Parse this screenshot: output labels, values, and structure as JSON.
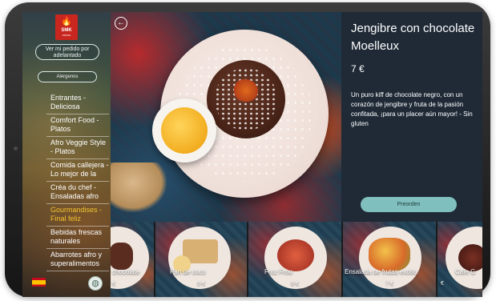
{
  "sidebar": {
    "logo": {
      "brand": "SMK",
      "sub": "SMOKE"
    },
    "order_button": "Ver mi pedido por adelantado",
    "allergens_button": "Alergenos",
    "categories": [
      {
        "label": "Entrantes - Deliciosa"
      },
      {
        "label": "Comfort Food - Platos"
      },
      {
        "label": "Afro Veggie Style - Platos"
      },
      {
        "label": "Comida callejera - Lo mejor de la"
      },
      {
        "label": "Créa du chef - Ensaladas afro"
      },
      {
        "label": "Gourmandises - Final feliz"
      },
      {
        "label": "Bebidas frescas naturales"
      },
      {
        "label": "Abarrotes afro y superalimentos"
      }
    ],
    "language_flag": "es-flag-icon"
  },
  "dish": {
    "title": "Jengibre con chocolate Moelleux",
    "price": "7 €",
    "description": "Un puro kiff de chocolate negro, con un corazón de jengibre y fruta de la pasión confitada, ¡para un placer aún mayor! - Sin gluten",
    "preorder_label": "Preorden"
  },
  "thumbnails": [
    {
      "name": "chocolate",
      "price": "€"
    },
    {
      "name": "Pan de coco",
      "price": "6 €"
    },
    {
      "name": "Froz Frou",
      "price": "6 €"
    },
    {
      "name": "Ensalada de frutas exótic",
      "price": "7 €"
    },
    {
      "name": "Cafe G",
      "price": "€"
    }
  ],
  "colors": {
    "accent": "#7fbfbd",
    "active_category": "#f2c230",
    "panel": "#1f2a36",
    "logo": "#c8261e"
  }
}
